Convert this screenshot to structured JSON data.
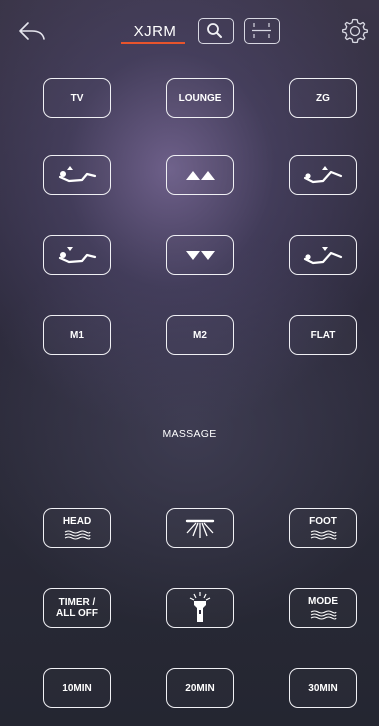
{
  "header": {
    "title": "XJRM"
  },
  "icons": {
    "back": "back-arrow-icon",
    "search": "search-icon",
    "scan": "scan-icon",
    "settings": "gear-icon"
  },
  "presets": {
    "tv_label": "TV",
    "lounge_label": "LOUNGE",
    "zg_label": "ZG"
  },
  "memory": {
    "m1_label": "M1",
    "m2_label": "M2",
    "flat_label": "FLAT"
  },
  "massage": {
    "section_label": "MASSAGE",
    "head_label": "HEAD",
    "foot_label": "FOOT",
    "timer_label_line1": "TIMER /",
    "timer_label_line2": "ALL OFF",
    "mode_label": "MODE"
  },
  "timers": {
    "t10_label": "10MIN",
    "t20_label": "20MIN",
    "t30_label": "30MIN"
  },
  "colors": {
    "accent": "#e8542c",
    "button_border": "#f0f0f4",
    "background": "#2b2938"
  }
}
